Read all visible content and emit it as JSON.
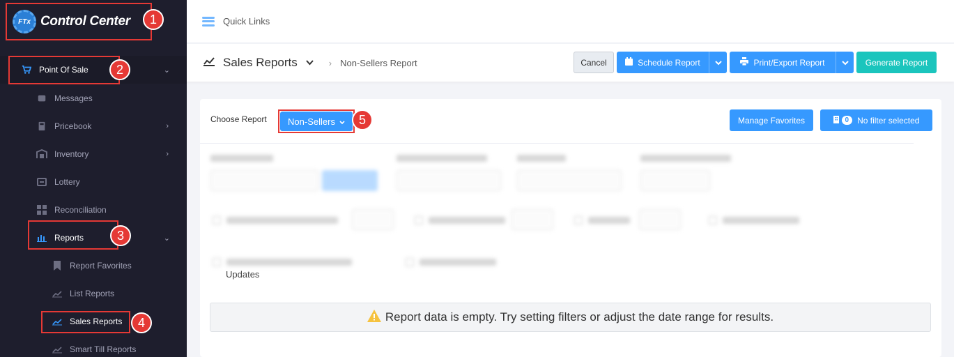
{
  "app": {
    "logo_mark": "FTx",
    "logo_text": "Control Center"
  },
  "topbar": {
    "quick_links": "Quick Links"
  },
  "sidebar": {
    "items": [
      {
        "label": "Point Of Sale",
        "icon": "cart-icon"
      },
      {
        "label": "Messages",
        "icon": "message-icon"
      },
      {
        "label": "Pricebook",
        "icon": "calculator-icon"
      },
      {
        "label": "Inventory",
        "icon": "warehouse-icon"
      },
      {
        "label": "Lottery",
        "icon": "ticket-icon"
      },
      {
        "label": "Reconciliation",
        "icon": "grid-icon"
      },
      {
        "label": "Reports",
        "icon": "bar-chart-icon"
      },
      {
        "label": "Report Favorites",
        "icon": "bookmark-icon"
      },
      {
        "label": "List Reports",
        "icon": "line-chart-icon"
      },
      {
        "label": "Sales Reports",
        "icon": "line-chart-icon"
      },
      {
        "label": "Smart Till Reports",
        "icon": "line-chart-icon"
      }
    ]
  },
  "subheader": {
    "title": "Sales Reports",
    "breadcrumb": "Non-Sellers Report",
    "cancel": "Cancel",
    "schedule": "Schedule Report",
    "print_export": "Print/Export Report",
    "generate": "Generate Report"
  },
  "card": {
    "choose_label": "Choose Report",
    "selected_report": "Non-Sellers",
    "manage_favorites": "Manage Favorites",
    "filter_count": "0",
    "filter_status": "No filter selected",
    "updates_text": "Updates",
    "empty_message": "Report data is empty. Try setting filters or adjust the date range for results."
  },
  "annotations": [
    "1",
    "2",
    "3",
    "4",
    "5"
  ],
  "colors": {
    "accent": "#3699ff",
    "teal": "#1bc5bd",
    "annotation": "#e53935",
    "sidebar": "#1e1e2d"
  }
}
